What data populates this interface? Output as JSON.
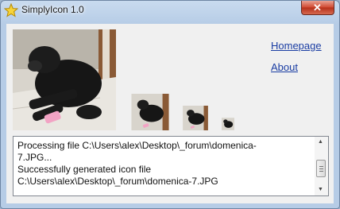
{
  "window": {
    "title": "SimplyIcon 1.0",
    "close_symbol": "✕"
  },
  "icons": {
    "app": "star-icon",
    "close": "close-icon"
  },
  "links": {
    "homepage": "Homepage",
    "about": "About"
  },
  "log": {
    "text": "Processing file C:\\Users\\alex\\Desktop\\_forum\\domenica-\n7.JPG...\nSuccessfully generated icon file\nC:\\Users\\alex\\Desktop\\_forum\\domenica-7.JPG"
  },
  "colors": {
    "link": "#1a3da3",
    "close_button": "#c8432a",
    "title_bar": "#b6cce6"
  }
}
